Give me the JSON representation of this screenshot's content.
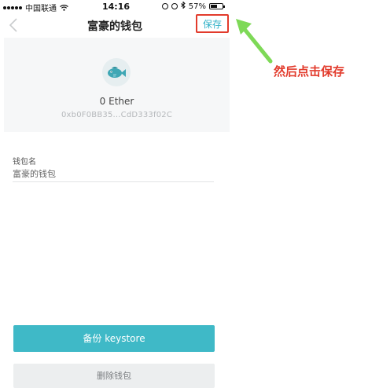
{
  "status_bar": {
    "carrier": "中国联通",
    "time": "14:16",
    "battery_percent": "57%"
  },
  "nav": {
    "title": "富豪的钱包",
    "save_label": "保存",
    "back_icon": "chevron-left-icon"
  },
  "wallet": {
    "avatar_icon": "fish-icon",
    "balance": "0 Ether",
    "address": "0xb0F0BB35...CdD333f02C"
  },
  "form": {
    "name_label": "钱包名",
    "name_value": "富豪的钱包"
  },
  "actions": {
    "backup_label": "备份 keystore",
    "delete_label": "删除钱包"
  },
  "annotation": {
    "text": "然后点击保存"
  },
  "colors": {
    "accent": "#3fb9c7",
    "highlight_box": "#e23b2c",
    "arrow": "#7ed957"
  }
}
